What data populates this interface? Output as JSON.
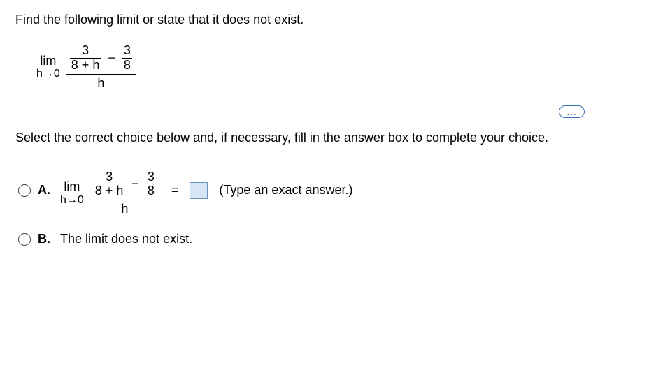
{
  "question": {
    "prompt": "Find the following limit or state that it does not exist.",
    "instruction": "Select the correct choice below and, if necessary, fill in the answer box to complete your choice."
  },
  "expression": {
    "lim_label": "lim",
    "lim_sub": "h→0",
    "frac1_num": "3",
    "frac1_den": "8 + h",
    "minus": "−",
    "frac2_num": "3",
    "frac2_den": "8",
    "outer_den": "h"
  },
  "more_button": "...",
  "choices": {
    "A": {
      "label": "A.",
      "equals": "=",
      "hint": "(Type an exact answer.)"
    },
    "B": {
      "label": "B.",
      "text": "The limit does not exist."
    }
  }
}
